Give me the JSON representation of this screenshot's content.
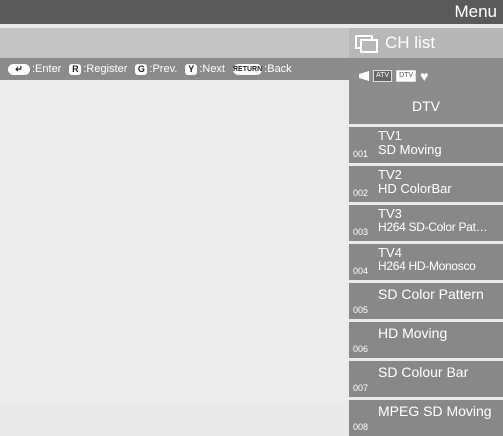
{
  "header": {
    "menu_title": "Menu"
  },
  "help_bar": {
    "items": [
      {
        "key": "↵",
        "label": ":Enter",
        "icon": "enter-key-icon"
      },
      {
        "key": "R",
        "label": ":Register",
        "icon": "r-key-icon"
      },
      {
        "key": "G",
        "label": ":Prev.",
        "icon": "g-key-icon"
      },
      {
        "key": "Y",
        "label": ":Next",
        "icon": "y-key-icon"
      },
      {
        "key": "RETURN",
        "label": ":Back",
        "icon": "return-key-icon"
      }
    ]
  },
  "side_panel": {
    "title": "CH list",
    "sources": {
      "atv": "ATV",
      "dtv": "DTV",
      "selected": "DTV"
    },
    "current_source_label": "DTV",
    "channels": [
      {
        "num": "001",
        "name": "TV1",
        "program": "SD Moving"
      },
      {
        "num": "002",
        "name": "TV2",
        "program": "HD ColorBar"
      },
      {
        "num": "003",
        "name": "TV3",
        "program": "H264 SD-Color Pat…"
      },
      {
        "num": "004",
        "name": "TV4",
        "program": "H264 HD-Monosco"
      },
      {
        "num": "005",
        "name": "SD Color Pattern"
      },
      {
        "num": "006",
        "name": "HD Moving"
      },
      {
        "num": "007",
        "name": "SD Colour Bar"
      },
      {
        "num": "008",
        "name": "MPEG SD Moving"
      }
    ]
  },
  "colors": {
    "topbar": "#5a5a5a",
    "row_bg": "#888888",
    "header_bg": "#b7b7b7"
  }
}
